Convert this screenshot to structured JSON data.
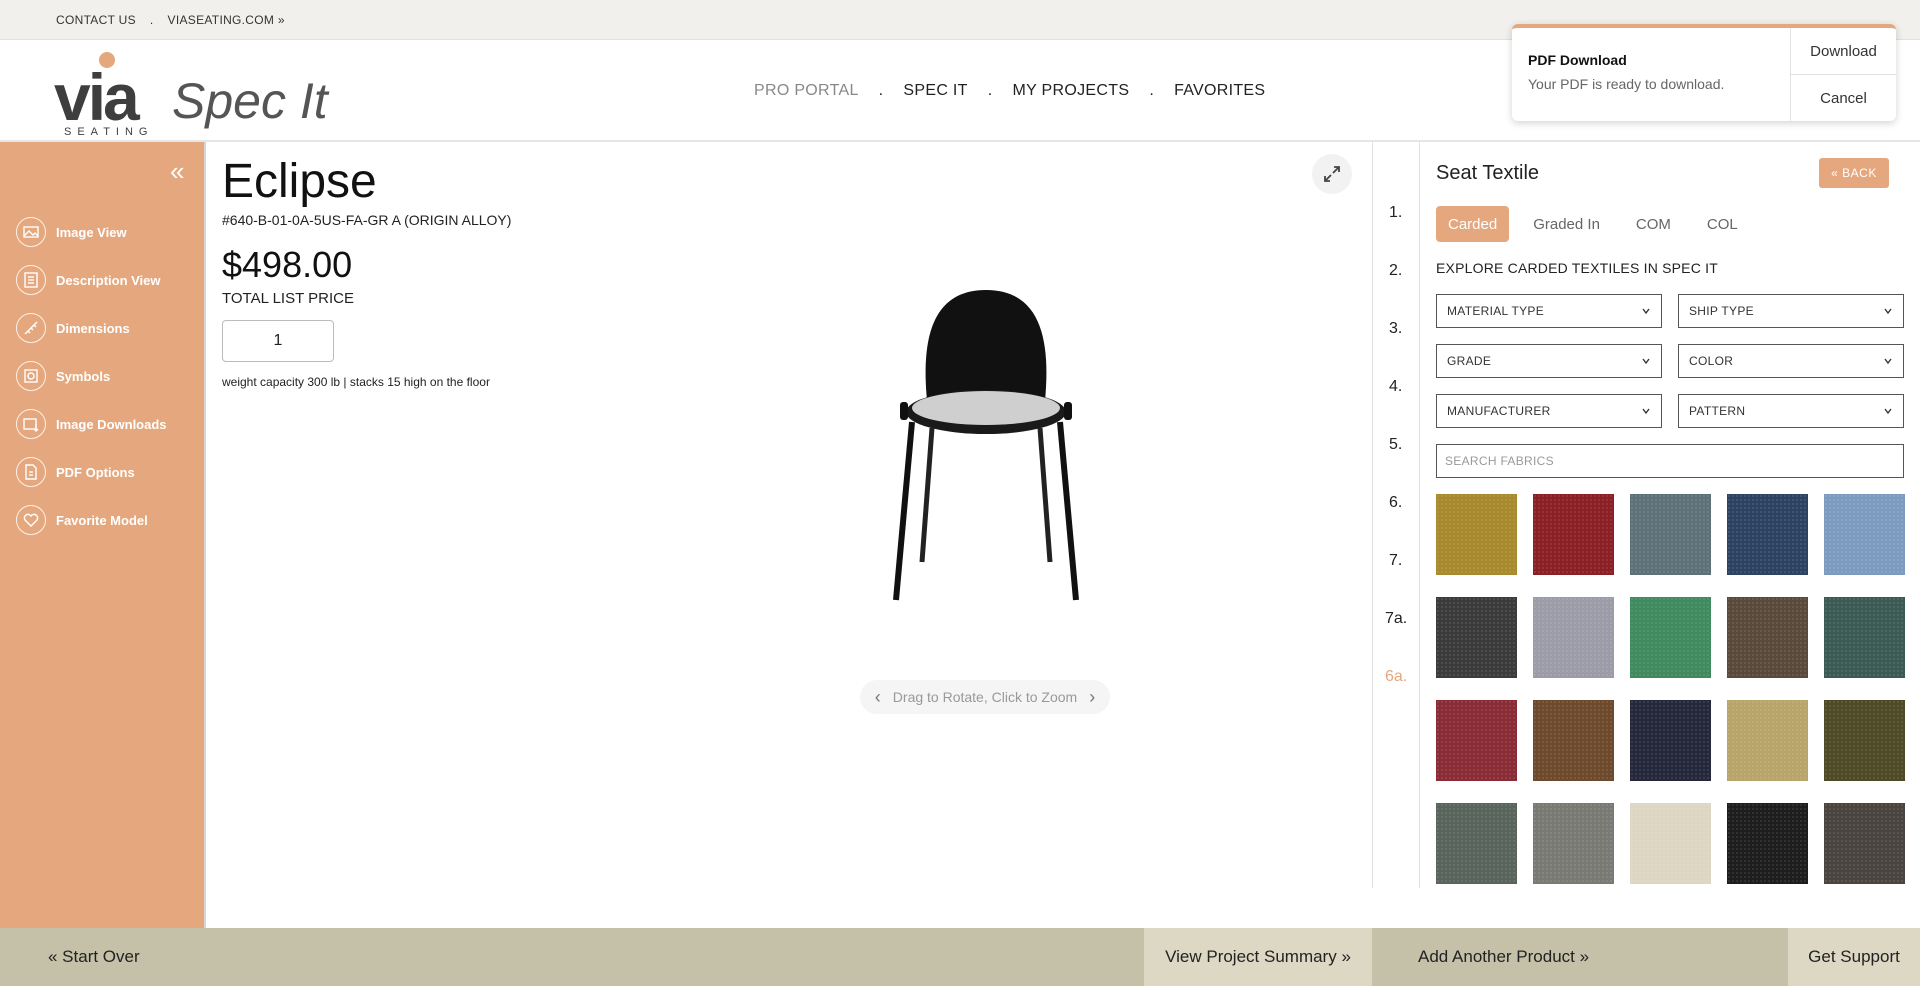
{
  "utility": {
    "contact": "CONTACT US",
    "sep": ".",
    "site": "VIASEATING.COM »"
  },
  "logo": {
    "via": "via",
    "seating": "SEATING",
    "specit": "Spec It"
  },
  "nav": {
    "items": [
      "PRO PORTAL",
      "SPEC IT",
      "MY PROJECTS",
      "FAVORITES"
    ],
    "sep": ".",
    "active": "PRO PORTAL"
  },
  "toast": {
    "title": "PDF Download",
    "message": "Your PDF is ready to download.",
    "download": "Download",
    "cancel": "Cancel"
  },
  "sidebar": {
    "collapse_icon": "«",
    "items": [
      {
        "label": "Image View",
        "icon": "image-icon"
      },
      {
        "label": "Description View",
        "icon": "list-icon"
      },
      {
        "label": "Dimensions",
        "icon": "ruler-icon"
      },
      {
        "label": "Symbols",
        "icon": "symbol-icon"
      },
      {
        "label": "Image Downloads",
        "icon": "download-image-icon"
      },
      {
        "label": "PDF Options",
        "icon": "pdf-icon"
      },
      {
        "label": "Favorite Model",
        "icon": "heart-icon"
      }
    ]
  },
  "product": {
    "title": "Eclipse",
    "sku": "#640-B-01-0A-5US-FA-GR A (ORIGIN ALLOY)",
    "price": "$498.00",
    "price_label": "TOTAL LIST PRICE",
    "quantity": "1",
    "note": "weight capacity 300 lb | stacks 15 high on the floor",
    "rotate_hint": "Drag to Rotate, Click to Zoom"
  },
  "steps": [
    "1.",
    "2.",
    "3.",
    "4.",
    "5.",
    "6.",
    "7.",
    "7a.",
    "6a."
  ],
  "panel": {
    "title": "Seat Textile",
    "back": "«  BACK",
    "tabs": [
      "Carded",
      "Graded In",
      "COM",
      "COL"
    ],
    "active_tab": "Carded",
    "explore": "EXPLORE CARDED TEXTILES IN SPEC IT",
    "filters": [
      "MATERIAL TYPE",
      "SHIP TYPE",
      "GRADE",
      "COLOR",
      "MANUFACTURER",
      "PATTERN"
    ],
    "search_placeholder": "SEARCH FABRICS",
    "swatches": [
      "#a88a2e",
      "#8a1f26",
      "#5c7178",
      "#2c4263",
      "#7b9cbf",
      "#3b3b3c",
      "#9c9ca8",
      "#3f8a5e",
      "#5a4a3c",
      "#3c5a54",
      "#8a2c36",
      "#6e4a2c",
      "#24283a",
      "#b8a56a",
      "#4e4a26",
      "#58645c",
      "#7a7a74",
      "#ddd6c2",
      "#1d1d1d",
      "#4a4440"
    ]
  },
  "footer": {
    "start_over": "« Start Over",
    "summary": "View Project Summary »",
    "add": "Add Another Product »",
    "support": "Get Support"
  },
  "colors": {
    "accent": "#e5a77d",
    "footer": "#c4c1a8",
    "footer_light": "#dcd8c3"
  }
}
